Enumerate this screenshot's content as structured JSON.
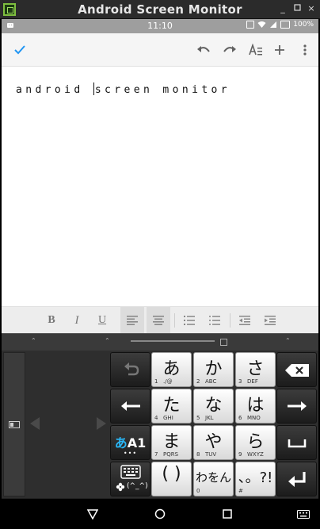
{
  "window": {
    "title": "Android Screen Monitor",
    "min_label": "_",
    "max_label": "▫",
    "close_label": "×"
  },
  "status_bar": {
    "clock": "11:10",
    "battery": "100%"
  },
  "toolbar": {
    "icons": [
      "check-icon",
      "undo-icon",
      "redo-icon",
      "text-format-icon",
      "add-icon",
      "more-vert-icon"
    ],
    "accent": "#2196f3"
  },
  "document": {
    "text_before_cursor": "android ",
    "text_after_cursor": "screen monitor"
  },
  "format_bar": {
    "bold": "B",
    "italic": "I",
    "underline": "U"
  },
  "keyboard": {
    "keys": {
      "a": {
        "main": "あ",
        "sub": "1",
        "sub2": "./@"
      },
      "ka": {
        "main": "か",
        "sub": "2",
        "sub2": "ABC"
      },
      "sa": {
        "main": "さ",
        "sub": "3",
        "sub2": "DEF"
      },
      "ta": {
        "main": "た",
        "sub": "4",
        "sub2": "GHI"
      },
      "na": {
        "main": "な",
        "sub": "5",
        "sub2": "JKL"
      },
      "ha": {
        "main": "は",
        "sub": "6",
        "sub2": "MNO"
      },
      "ma": {
        "main": "ま",
        "sub": "7",
        "sub2": "PQRS"
      },
      "ya": {
        "main": "や",
        "sub": "8",
        "sub2": "TUV"
      },
      "ra": {
        "main": "ら",
        "sub": "9",
        "sub2": "WXYZ"
      },
      "paren": {
        "main": "( )",
        "sub": "",
        "sub2": ""
      },
      "wa": {
        "main": "わをん",
        "sub": "0",
        "sub2": ""
      },
      "punct": {
        "main": "、。?!",
        "sub": "#",
        "sub2": ""
      }
    },
    "mode_key": {
      "kana": "あ",
      "alpha": "A1",
      "dots": "•••"
    },
    "emoji_key": {
      "label": "(^_^)"
    }
  }
}
